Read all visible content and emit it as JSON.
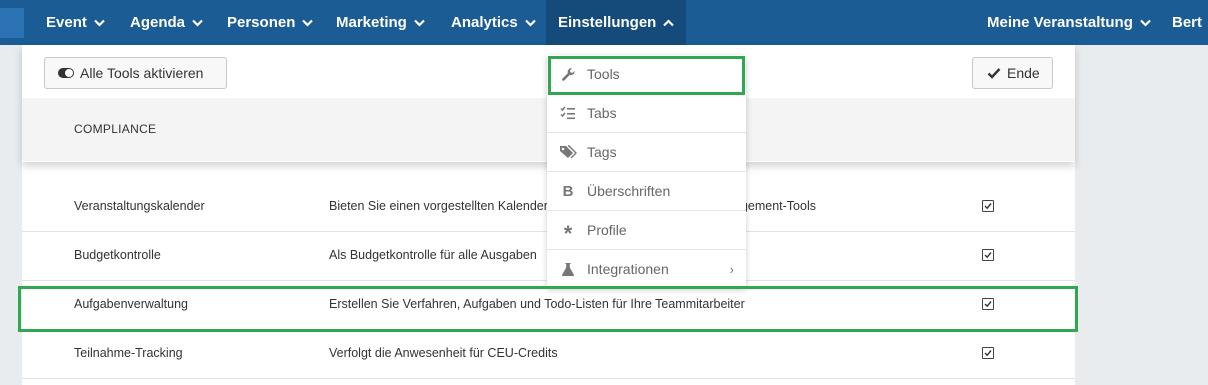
{
  "nav": {
    "items": [
      {
        "label": "Event"
      },
      {
        "label": "Agenda"
      },
      {
        "label": "Personen"
      },
      {
        "label": "Marketing"
      },
      {
        "label": "Analytics"
      },
      {
        "label": "Einstellungen"
      }
    ],
    "right": [
      {
        "label": "Meine Veranstaltung"
      },
      {
        "label": "Bert"
      }
    ]
  },
  "toolbar": {
    "activate_all_label": "Alle Tools aktivieren",
    "done_label": "Ende"
  },
  "section": {
    "title": "COMPLIANCE"
  },
  "dropdown": {
    "items": [
      {
        "label": "Tools",
        "icon": "wrench-icon"
      },
      {
        "label": "Tabs",
        "icon": "checklist-icon"
      },
      {
        "label": "Tags",
        "icon": "tags-icon"
      },
      {
        "label": "Überschriften",
        "icon": "bold-icon"
      },
      {
        "label": "Profile",
        "icon": "asterisk-icon"
      },
      {
        "label": "Integrationen",
        "icon": "flask-icon"
      }
    ]
  },
  "rows": [
    {
      "name": "Veranstaltungskalender",
      "desc": "Bieten Sie einen vorgestellten Kalender",
      "desc_right": "agement-Tools",
      "checked": true
    },
    {
      "name": "Budgetkontrolle",
      "desc": "Als Budgetkontrolle für alle Ausgaben",
      "checked": true
    },
    {
      "name": "Aufgabenverwaltung",
      "desc": "Erstellen Sie Verfahren, Aufgaben und Todo-Listen für Ihre Teammitarbeiter",
      "checked": true
    },
    {
      "name": "Teilnahme-Tracking",
      "desc": "Verfolgt die Anwesenheit für CEU-Credits",
      "checked": true
    }
  ],
  "colors": {
    "topbar": "#1b5c94",
    "highlight": "#2fa84f"
  }
}
